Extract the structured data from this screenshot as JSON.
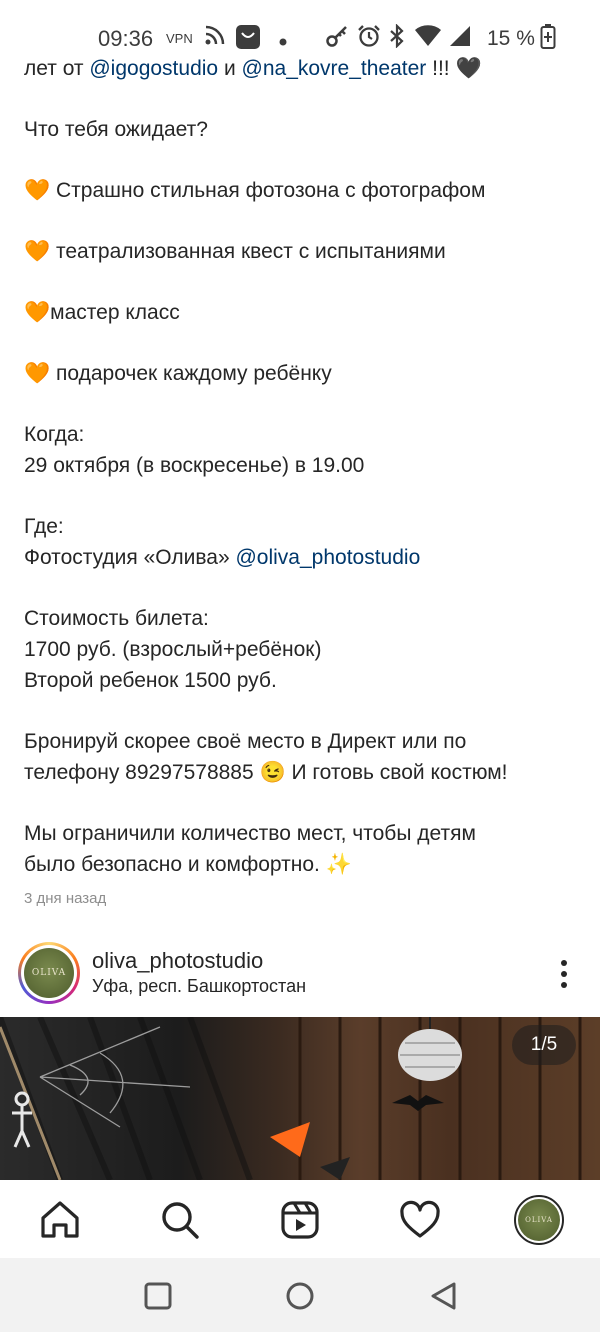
{
  "status_bar": {
    "time": "09:36",
    "vpn": "VPN",
    "battery": "15 %",
    "icons": [
      "rss-icon",
      "notification-app-icon",
      "dot-icon",
      "key-icon",
      "alarm-icon",
      "bluetooth-icon",
      "wifi-icon",
      "signal-icon",
      "battery-charging-icon"
    ]
  },
  "caption": {
    "line1": {
      "pre": "лет от ",
      "mention1": "@igogostudio",
      "mid": " и ",
      "mention2": "@na_kovre_theater",
      "post": " !!! 🖤"
    },
    "line2": "Что тебя ожидает?",
    "line3": {
      "emoji": "🧡",
      "text": " Страшно стильная фотозона с фотографом"
    },
    "line4": {
      "emoji": "🧡",
      "text": " театрализованная квест с испытаниями"
    },
    "line5": {
      "emoji": "🧡",
      "text": "мастер класс"
    },
    "line6": {
      "emoji": "🧡",
      "text": " подарочек каждому ребёнку"
    },
    "line7": "Когда:",
    "line8": "29 октября (в воскресенье) в 19.00",
    "line9": "Где:",
    "line10": {
      "pre": "Фотостудия «Олива» ",
      "mention": "@oliva_photostudio"
    },
    "line11": "Стоимость билета:",
    "line12": "1700 руб. (взрослый+ребёнок)",
    "line13": "Второй ребенок 1500 руб.",
    "line14": "Бронируй скорее своё место в Директ или по",
    "line15": "телефону 89297578885 😉 И готовь свой костюм!",
    "line16": "Мы ограничили количество мест, чтобы детям",
    "line17": "было безопасно и комфортно. ✨",
    "time_ago": "3 дня назад"
  },
  "post": {
    "username": "oliva_photostudio",
    "location": "Уфа, респ. Башкортостан",
    "avatar_text": "OLIVA",
    "counter": "1/5"
  },
  "bottom_nav": {
    "items": [
      "home-icon",
      "search-icon",
      "reels-icon",
      "heart-icon",
      "profile-avatar"
    ],
    "avatar_text": "OLIVA"
  },
  "system_nav": [
    "recents-button",
    "home-button",
    "back-button"
  ],
  "colors": {
    "mention": "#00376b",
    "heart": "#ff8c1a",
    "text": "#262626",
    "muted": "#8e8e8e"
  }
}
